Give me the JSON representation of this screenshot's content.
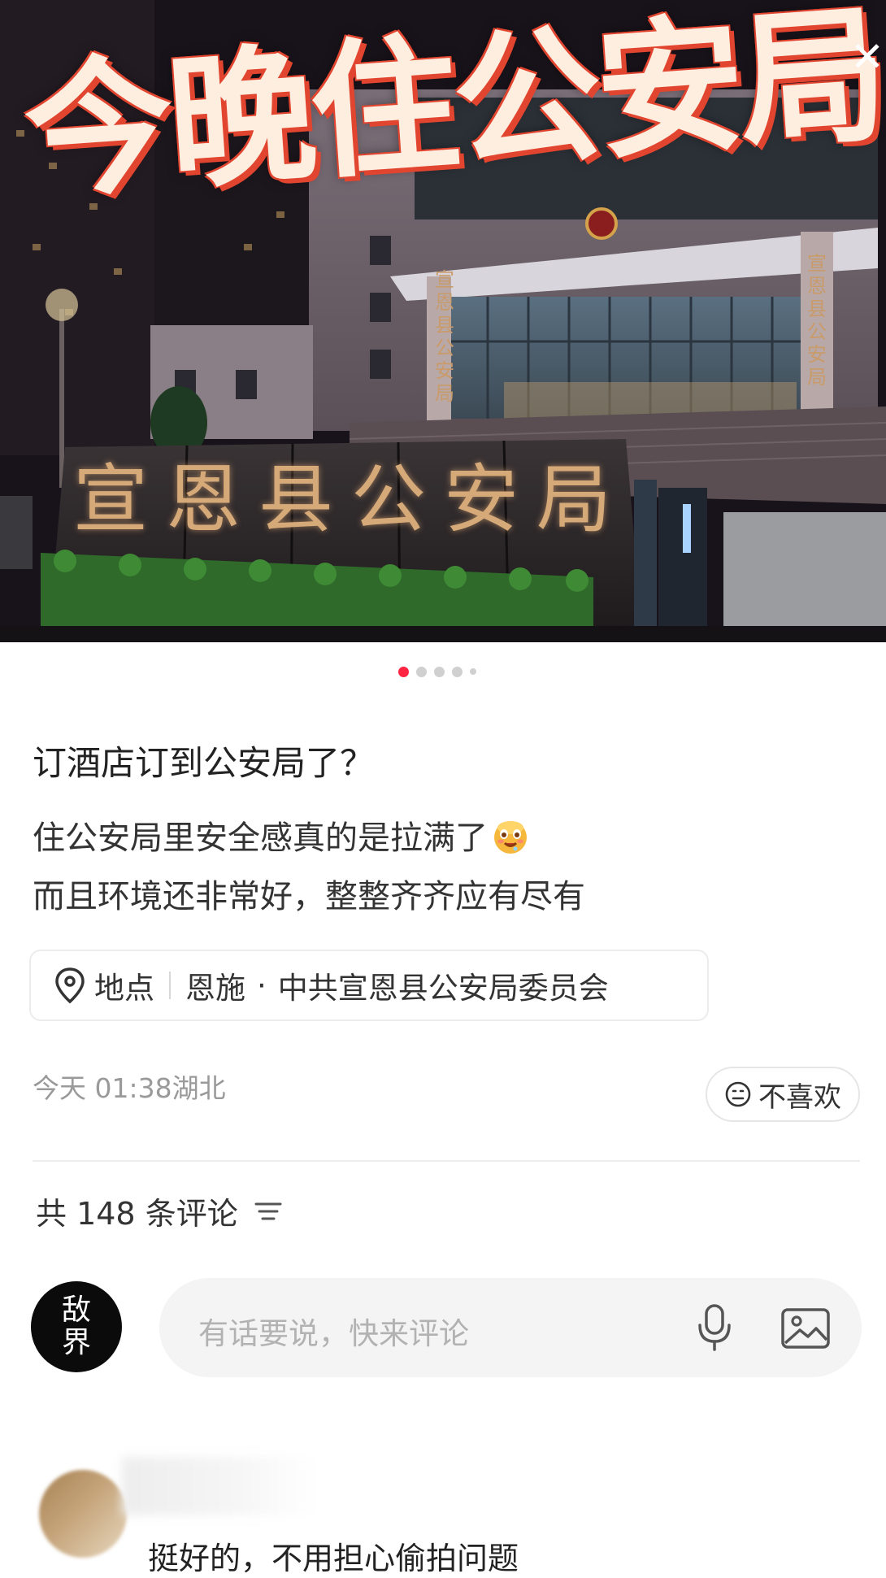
{
  "hero": {
    "overlay_title": "今晚住公安局",
    "sign_text": "宣恩县公安局",
    "pillar_text": "宣恩县公安局",
    "close_glyph": "✕",
    "image_count": 5,
    "active_index": 0
  },
  "post": {
    "title": "订酒店订到公安局了？",
    "body_lines": [
      "住公安局里安全感真的是拉满了",
      "而且环境还非常好，整整齐齐应有尽有"
    ],
    "emoji_icon": "drooling-face-icon"
  },
  "location": {
    "label": "地点",
    "city": "恩施",
    "dot": "·",
    "place": "中共宣恩县公安局委员会",
    "icon": "location-pin-icon"
  },
  "meta": {
    "time": "今天 01:38",
    "region": "湖北",
    "dislike_label": "不喜欢"
  },
  "comments": {
    "count_text": "共 148 条评论",
    "input_placeholder": "有话要说，快来评论",
    "my_avatar_text": [
      "敌",
      "界"
    ],
    "first_comment": {
      "text": "挺好的，不用担心偷拍问题"
    }
  },
  "colors": {
    "accent": "#ff2442",
    "title_fill": "#fdeee0",
    "title_outline": "#e2452f"
  }
}
